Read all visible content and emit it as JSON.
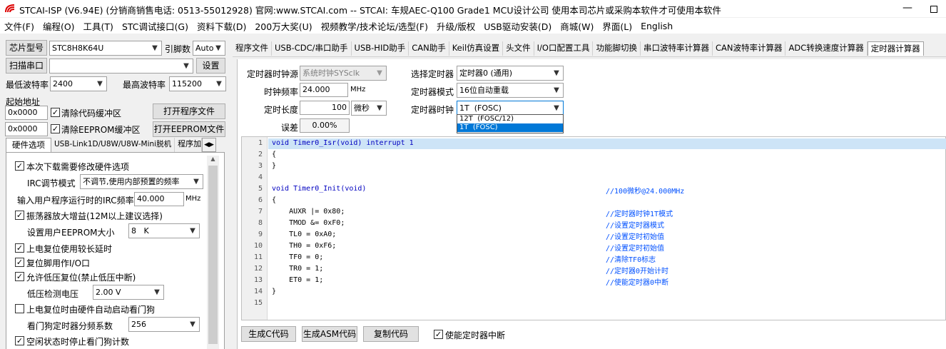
{
  "window": {
    "title": "STCAI-ISP (V6.94E) (分销商销售电话: 0513-55012928) 官网:www.STCAI.com  -- STCAI: 车规AEC-Q100 Grade1 MCU设计公司 使用本司芯片或采购本软件才可使用本软件",
    "minimize": "—"
  },
  "menu": [
    "文件(F)",
    "编程(O)",
    "工具(T)",
    "STC调试接口(G)",
    "资料下载(D)",
    "200万大奖(U)",
    "视频教学/技术论坛/选型(F)",
    "升级/版权",
    "USB驱动安装(D)",
    "商城(W)",
    "界面(L)",
    "English"
  ],
  "left": {
    "chip_model_label": "芯片型号",
    "chip_model_value": "STC8H8K64U",
    "pin_count_label": "引脚数",
    "pin_count_value": "Auto",
    "scan_port_label": "扫描串口",
    "port_value": "",
    "settings_button": "设置",
    "min_baud_label": "最低波特率",
    "min_baud_value": "2400",
    "max_baud_label": "最高波特率",
    "max_baud_value": "115200",
    "start_addr_label": "起始地址",
    "addr1_value": "0x0000",
    "clear_code_label": "清除代码缓冲区",
    "open_prog_button": "打开程序文件",
    "addr2_value": "0x0000",
    "clear_eeprom_label": "清除EEPROM缓冲区",
    "open_eeprom_button": "打开EEPROM文件",
    "tabs": [
      "硬件选项",
      "USB-Link1D/U8W/U8W-Mini脱机",
      "程序加"
    ],
    "hw": {
      "modify_hw": "本次下载需要修改硬件选项",
      "irc_mode_label": "IRC调节模式",
      "irc_mode_value": "不调节,使用内部预置的频率",
      "irc_freq_label": "输入用户程序运行时的IRC频率",
      "irc_freq_value": "40.000",
      "irc_freq_unit": "MHz",
      "osc_gain": "振荡器放大增益(12M以上建议选择)",
      "eeprom_size_label": "设置用户EEPROM大小",
      "eeprom_size_value": "8   K",
      "por_delay": "上电复位使用较长延时",
      "reset_pin_io": "复位脚用作I/O口",
      "lvr": "允许低压复位(禁止低压中断)",
      "lv_detect_label": "低压检测电压",
      "lv_detect_value": "2.00 V",
      "wdt_auto": "上电复位时由硬件自动启动看门狗",
      "wdt_div_label": "看门狗定时器分频系数",
      "wdt_div_value": "256",
      "idle_wdt_stop": "空闲状态时停止看门狗计数"
    }
  },
  "right_tabs": [
    "程序文件",
    "USB-CDC/串口助手",
    "USB-HID助手",
    "CAN助手",
    "Keil仿真设置",
    "头文件",
    "I/O口配置工具",
    "功能脚切换",
    "串口波特率计算器",
    "CAN波特率计算器",
    "ADC转换速度计算器",
    "定时器计算器"
  ],
  "timer": {
    "clk_source_label": "定时器时钟源",
    "clk_source_value": "系统时钟SYSclk",
    "clk_freq_label": "时钟频率",
    "clk_freq_value": "24.000",
    "clk_freq_unit": "MHz",
    "length_label": "定时长度",
    "length_value": "100",
    "length_unit": "微秒",
    "error_label": "误差",
    "error_value": "0.00%",
    "select_timer_label": "选择定时器",
    "select_timer_value": "定时器0 (通用)",
    "mode_label": "定时器模式",
    "mode_value": "16位自动重载",
    "clock_label": "定时器时钟",
    "clock_value": "1T  (FOSC)",
    "clock_options": [
      "12T  (FOSC/12)",
      "1T  (FOSC)"
    ]
  },
  "code_lines": [
    {
      "n": "1",
      "text": "void Timer0_Isr(void) interrupt 1",
      "comment": ""
    },
    {
      "n": "2",
      "text": "{",
      "comment": ""
    },
    {
      "n": "3",
      "text": "}",
      "comment": ""
    },
    {
      "n": "4",
      "text": "",
      "comment": ""
    },
    {
      "n": "5",
      "text": "void Timer0_Init(void)",
      "comment": "//100微秒@24.000MHz"
    },
    {
      "n": "6",
      "text": "{",
      "comment": ""
    },
    {
      "n": "7",
      "text": "    AUXR |= 0x80;",
      "comment": "//定时器时钟1T模式"
    },
    {
      "n": "8",
      "text": "    TMOD &= 0xF0;",
      "comment": "//设置定时器模式"
    },
    {
      "n": "9",
      "text": "    TL0 = 0xA0;",
      "comment": "//设置定时初始值"
    },
    {
      "n": "10",
      "text": "    TH0 = 0xF6;",
      "comment": "//设置定时初始值"
    },
    {
      "n": "11",
      "text": "    TF0 = 0;",
      "comment": "//清除TF0标志"
    },
    {
      "n": "12",
      "text": "    TR0 = 1;",
      "comment": "//定时器0开始计时"
    },
    {
      "n": "13",
      "text": "    ET0 = 1;",
      "comment": "//使能定时器0中断"
    },
    {
      "n": "14",
      "text": "}",
      "comment": ""
    },
    {
      "n": "15",
      "text": "",
      "comment": ""
    }
  ],
  "bottom": {
    "gen_c": "生成C代码",
    "gen_asm": "生成ASM代码",
    "copy_code": "复制代码",
    "enable_int": "使能定时器中断"
  }
}
